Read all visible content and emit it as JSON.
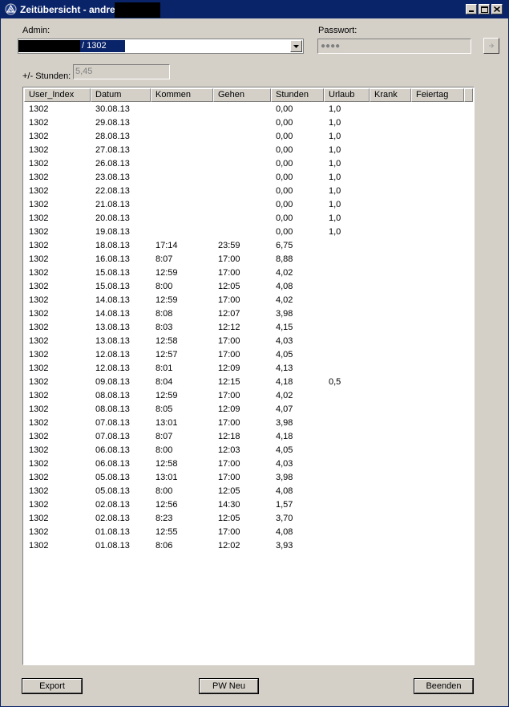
{
  "window": {
    "title": "Zeitübersicht - andreas_"
  },
  "form": {
    "admin_label": "Admin:",
    "admin_value": "/ 1302",
    "password_label": "Passwort:",
    "password_value": "●●●●",
    "hours_label": "+/- Stunden:",
    "hours_value": "5,45"
  },
  "table": {
    "columns": [
      "User_Index",
      "Datum",
      "Kommen",
      "Gehen",
      "Stunden",
      "Urlaub",
      "Krank",
      "Feiertag"
    ],
    "rows": [
      [
        "1302",
        "30.08.13",
        "",
        "",
        "0,00",
        "1,0",
        "",
        ""
      ],
      [
        "1302",
        "29.08.13",
        "",
        "",
        "0,00",
        "1,0",
        "",
        ""
      ],
      [
        "1302",
        "28.08.13",
        "",
        "",
        "0,00",
        "1,0",
        "",
        ""
      ],
      [
        "1302",
        "27.08.13",
        "",
        "",
        "0,00",
        "1,0",
        "",
        ""
      ],
      [
        "1302",
        "26.08.13",
        "",
        "",
        "0,00",
        "1,0",
        "",
        ""
      ],
      [
        "1302",
        "23.08.13",
        "",
        "",
        "0,00",
        "1,0",
        "",
        ""
      ],
      [
        "1302",
        "22.08.13",
        "",
        "",
        "0,00",
        "1,0",
        "",
        ""
      ],
      [
        "1302",
        "21.08.13",
        "",
        "",
        "0,00",
        "1,0",
        "",
        ""
      ],
      [
        "1302",
        "20.08.13",
        "",
        "",
        "0,00",
        "1,0",
        "",
        ""
      ],
      [
        "1302",
        "19.08.13",
        "",
        "",
        "0,00",
        "1,0",
        "",
        ""
      ],
      [
        "1302",
        "18.08.13",
        "17:14",
        "23:59",
        "6,75",
        "",
        "",
        ""
      ],
      [
        "1302",
        "16.08.13",
        "8:07",
        "17:00",
        "8,88",
        "",
        "",
        ""
      ],
      [
        "1302",
        "15.08.13",
        "12:59",
        "17:00",
        "4,02",
        "",
        "",
        ""
      ],
      [
        "1302",
        "15.08.13",
        "8:00",
        "12:05",
        "4,08",
        "",
        "",
        ""
      ],
      [
        "1302",
        "14.08.13",
        "12:59",
        "17:00",
        "4,02",
        "",
        "",
        ""
      ],
      [
        "1302",
        "14.08.13",
        "8:08",
        "12:07",
        "3,98",
        "",
        "",
        ""
      ],
      [
        "1302",
        "13.08.13",
        "8:03",
        "12:12",
        "4,15",
        "",
        "",
        ""
      ],
      [
        "1302",
        "13.08.13",
        "12:58",
        "17:00",
        "4,03",
        "",
        "",
        ""
      ],
      [
        "1302",
        "12.08.13",
        "12:57",
        "17:00",
        "4,05",
        "",
        "",
        ""
      ],
      [
        "1302",
        "12.08.13",
        "8:01",
        "12:09",
        "4,13",
        "",
        "",
        ""
      ],
      [
        "1302",
        "09.08.13",
        "8:04",
        "12:15",
        "4,18",
        "0,5",
        "",
        ""
      ],
      [
        "1302",
        "08.08.13",
        "12:59",
        "17:00",
        "4,02",
        "",
        "",
        ""
      ],
      [
        "1302",
        "08.08.13",
        "8:05",
        "12:09",
        "4,07",
        "",
        "",
        ""
      ],
      [
        "1302",
        "07.08.13",
        "13:01",
        "17:00",
        "3,98",
        "",
        "",
        ""
      ],
      [
        "1302",
        "07.08.13",
        "8:07",
        "12:18",
        "4,18",
        "",
        "",
        ""
      ],
      [
        "1302",
        "06.08.13",
        "8:00",
        "12:03",
        "4,05",
        "",
        "",
        ""
      ],
      [
        "1302",
        "06.08.13",
        "12:58",
        "17:00",
        "4,03",
        "",
        "",
        ""
      ],
      [
        "1302",
        "05.08.13",
        "13:01",
        "17:00",
        "3,98",
        "",
        "",
        ""
      ],
      [
        "1302",
        "05.08.13",
        "8:00",
        "12:05",
        "4,08",
        "",
        "",
        ""
      ],
      [
        "1302",
        "02.08.13",
        "12:56",
        "14:30",
        "1,57",
        "",
        "",
        ""
      ],
      [
        "1302",
        "02.08.13",
        "8:23",
        "12:05",
        "3,70",
        "",
        "",
        ""
      ],
      [
        "1302",
        "01.08.13",
        "12:55",
        "17:00",
        "4,08",
        "",
        "",
        ""
      ],
      [
        "1302",
        "01.08.13",
        "8:06",
        "12:02",
        "3,93",
        "",
        "",
        ""
      ]
    ]
  },
  "buttons": {
    "export": "Export",
    "pw_neu": "PW Neu",
    "beenden": "Beenden"
  }
}
